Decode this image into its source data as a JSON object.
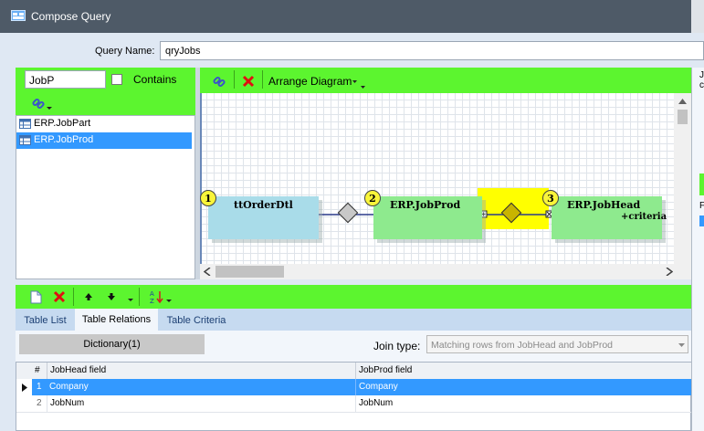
{
  "window": {
    "title": "Compose Query"
  },
  "query_name": {
    "label": "Query Name:",
    "value": "qryJobs"
  },
  "table_search": {
    "value": "JobP",
    "contains_label": "Contains"
  },
  "table_list": {
    "items": [
      {
        "label": "ERP.JobPart",
        "selected": false
      },
      {
        "label": "ERP.JobProd",
        "selected": true
      }
    ]
  },
  "diagram_toolbar": {
    "arrange_label": "Arrange Diagram"
  },
  "diagram": {
    "nodes": [
      {
        "num": "1",
        "name": "ttOrderDtl",
        "extra": ""
      },
      {
        "num": "2",
        "name": "ERP.JobProd",
        "extra": ""
      },
      {
        "num": "3",
        "name": "ERP.JobHead",
        "extra": "+criteria"
      }
    ]
  },
  "right_panel": {
    "text_top": "J",
    "text_sub": "c",
    "text_f": "F"
  },
  "tabs": [
    {
      "label": "Table List",
      "active": false
    },
    {
      "label": "Table Relations",
      "active": true
    },
    {
      "label": "Table Criteria",
      "active": false
    }
  ],
  "relations": {
    "dictionary_label": "Dictionary(1)",
    "join_type_label": "Join type:",
    "join_type_value": "Matching rows from JobHead and JobProd",
    "columns": [
      "#",
      "JobHead field",
      "JobProd field"
    ],
    "rows": [
      {
        "num": "1",
        "jobhead": "Company",
        "jobprod": "Company",
        "selected": true
      },
      {
        "num": "2",
        "jobhead": "JobNum",
        "jobprod": "JobNum",
        "selected": false
      }
    ]
  },
  "colors": {
    "toolbar_green": "#5cf52f",
    "selection_blue": "#3399ff",
    "node_blue": "#a9dce9",
    "node_green": "#8eea8e",
    "highlight_yellow": "#ffff00"
  }
}
